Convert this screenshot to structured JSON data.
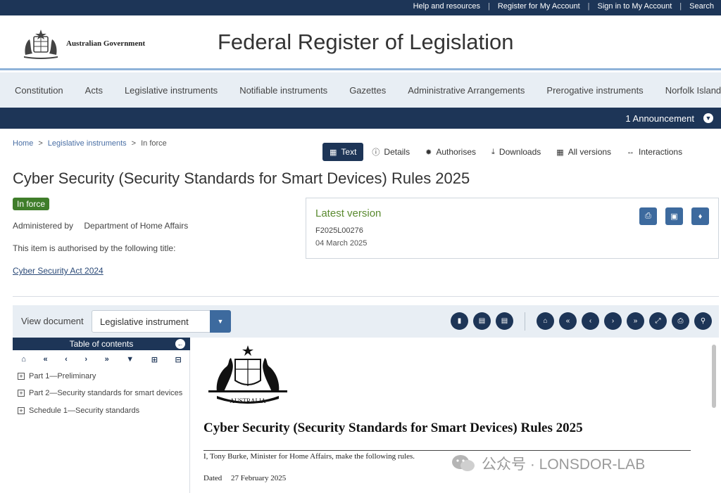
{
  "topbar": {
    "links": [
      "Help and resources",
      "Register for My Account",
      "Sign in to My Account",
      "Search"
    ]
  },
  "header": {
    "gov_name": "Australian Government",
    "site_title": "Federal Register of Legislation"
  },
  "mainnav": {
    "items": [
      "Constitution",
      "Acts",
      "Legislative instruments",
      "Notifiable instruments",
      "Gazettes",
      "Administrative Arrangements",
      "Prerogative instruments",
      "Norfolk Island"
    ]
  },
  "announcement": {
    "text": "1 Announcement"
  },
  "breadcrumb": {
    "home": "Home",
    "sep": ">",
    "section": "Legislative instruments",
    "current": "In force"
  },
  "tabs": [
    {
      "label": "Text",
      "icon": "document-icon",
      "active": true
    },
    {
      "label": "Details",
      "icon": "info-icon"
    },
    {
      "label": "Authorises",
      "icon": "gear-icon"
    },
    {
      "label": "Downloads",
      "icon": "download-icon"
    },
    {
      "label": "All versions",
      "icon": "calendar-icon"
    },
    {
      "label": "Interactions",
      "icon": "arrows-icon"
    }
  ],
  "document": {
    "title": "Cyber Security (Security Standards for Smart Devices) Rules 2025",
    "status": "In force",
    "administered_label": "Administered by",
    "department": "Department of Home Affairs",
    "authorised_text": "This item is authorised by the following title:",
    "authorising_act": "Cyber Security Act 2024"
  },
  "latest_version": {
    "title": "Latest version",
    "id": "F2025L00276",
    "date": "04 March 2025",
    "buttons": [
      "print-icon",
      "save-icon",
      "bell-icon"
    ]
  },
  "viewer": {
    "label": "View document",
    "selected": "Legislative instrument"
  },
  "toc": {
    "title": "Table of contents",
    "items": [
      "Part 1—Preliminary",
      "Part 2—Security standards for smart devices",
      "Schedule 1—Security standards"
    ]
  },
  "doc_body": {
    "coat_label": "AUSTRALIA",
    "heading": "Cyber Security (Security Standards for Smart Devices) Rules 2025",
    "intro": "I, Tony Burke, Minister for Home Affairs, make the following rules.",
    "dated_label": "Dated",
    "dated_value": "27 February 2025"
  },
  "watermark": {
    "text": "公众号 · LONSDOR-LAB"
  },
  "colors": {
    "navy": "#1d3557",
    "accent_blue": "#3d6a9e",
    "status_green": "#3f7d2a",
    "latest_green": "#5a8a2f"
  }
}
